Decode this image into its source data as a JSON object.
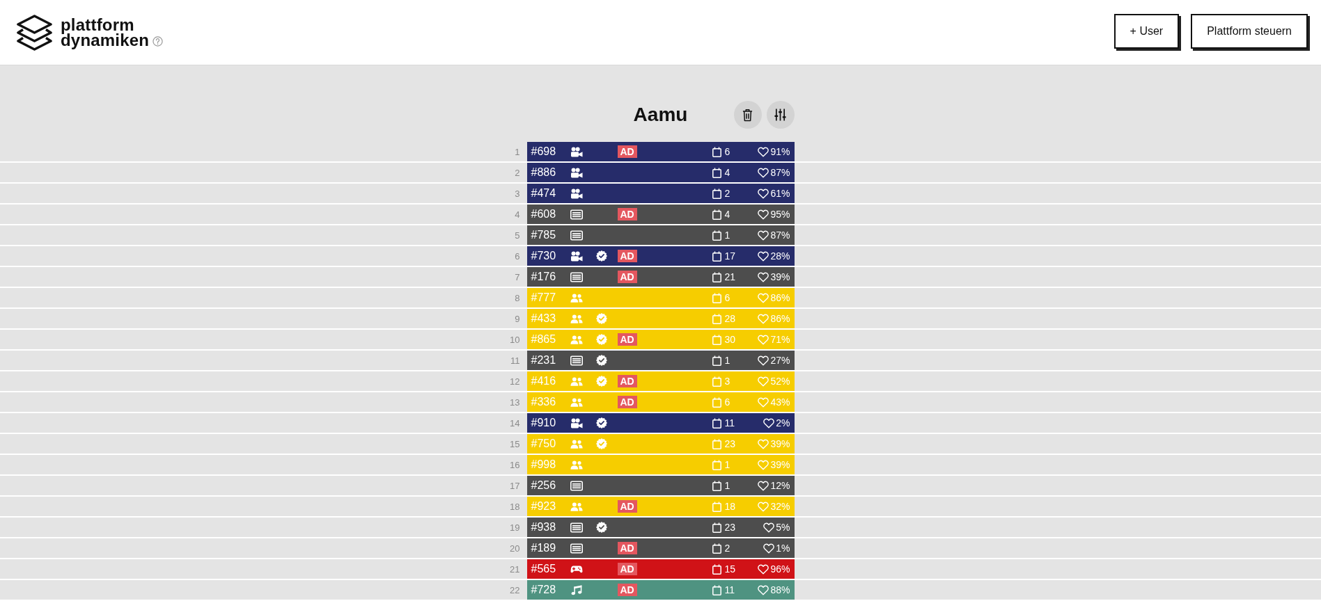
{
  "header": {
    "logo": {
      "lines": [
        "plattform",
        "dynamiken"
      ]
    },
    "buttons": [
      {
        "label": "+ User"
      },
      {
        "label": "Plattform steuern"
      }
    ]
  },
  "list": {
    "title": "Aamu",
    "rows": [
      {
        "number": "1",
        "id": "#698",
        "kind": "video",
        "color": "#262c6a",
        "verified": false,
        "badge": "AD",
        "days": "6",
        "likes": "91%"
      },
      {
        "number": "2",
        "id": "#886",
        "kind": "video",
        "color": "#262c6a",
        "verified": false,
        "days": "4",
        "likes": "87%"
      },
      {
        "number": "3",
        "id": "#474",
        "kind": "video",
        "color": "#262c6a",
        "verified": false,
        "days": "2",
        "likes": "61%"
      },
      {
        "number": "4",
        "id": "#608",
        "kind": "article",
        "color": "#4d4d4d",
        "verified": false,
        "badge": "AD",
        "days": "4",
        "likes": "95%"
      },
      {
        "number": "5",
        "id": "#785",
        "kind": "article",
        "color": "#4d4d4d",
        "verified": false,
        "days": "1",
        "likes": "87%"
      },
      {
        "number": "6",
        "id": "#730",
        "kind": "video",
        "color": "#262c6a",
        "verified": true,
        "badge": "AD",
        "days": "17",
        "likes": "28%"
      },
      {
        "number": "7",
        "id": "#176",
        "kind": "article",
        "color": "#4d4d4d",
        "verified": false,
        "badge": "AD",
        "days": "21",
        "likes": "39%"
      },
      {
        "number": "8",
        "id": "#777",
        "kind": "community",
        "color": "#f6cd00",
        "verified": false,
        "days": "6",
        "likes": "86%"
      },
      {
        "number": "9",
        "id": "#433",
        "kind": "community",
        "color": "#f6cd00",
        "verified": true,
        "days": "28",
        "likes": "86%"
      },
      {
        "number": "10",
        "id": "#865",
        "kind": "community",
        "color": "#f6cd00",
        "verified": true,
        "badge": "AD",
        "days": "30",
        "likes": "71%"
      },
      {
        "number": "11",
        "id": "#231",
        "kind": "article",
        "color": "#4d4d4d",
        "verified": true,
        "days": "1",
        "likes": "27%"
      },
      {
        "number": "12",
        "id": "#416",
        "kind": "community",
        "color": "#f6cd00",
        "verified": true,
        "badge": "AD",
        "days": "3",
        "likes": "52%"
      },
      {
        "number": "13",
        "id": "#336",
        "kind": "community",
        "color": "#f6cd00",
        "verified": false,
        "badge": "AD",
        "days": "6",
        "likes": "43%"
      },
      {
        "number": "14",
        "id": "#910",
        "kind": "video",
        "color": "#262c6a",
        "verified": true,
        "days": "11",
        "likes": "2%"
      },
      {
        "number": "15",
        "id": "#750",
        "kind": "community",
        "color": "#f6cd00",
        "verified": true,
        "days": "23",
        "likes": "39%"
      },
      {
        "number": "16",
        "id": "#998",
        "kind": "community",
        "color": "#f6cd00",
        "verified": false,
        "days": "1",
        "likes": "39%"
      },
      {
        "number": "17",
        "id": "#256",
        "kind": "article",
        "color": "#4d4d4d",
        "verified": false,
        "days": "1",
        "likes": "12%"
      },
      {
        "number": "18",
        "id": "#923",
        "kind": "community",
        "color": "#f6cd00",
        "verified": false,
        "badge": "AD",
        "days": "18",
        "likes": "32%"
      },
      {
        "number": "19",
        "id": "#938",
        "kind": "article",
        "color": "#4d4d4d",
        "verified": true,
        "days": "23",
        "likes": "5%"
      },
      {
        "number": "20",
        "id": "#189",
        "kind": "article",
        "color": "#4d4d4d",
        "verified": false,
        "badge": "AD",
        "days": "2",
        "likes": "1%"
      },
      {
        "number": "21",
        "id": "#565",
        "kind": "game",
        "color": "#d01217",
        "verified": false,
        "badge": "AD",
        "days": "15",
        "likes": "96%"
      },
      {
        "number": "22",
        "id": "#728",
        "kind": "music",
        "color": "#4f9381",
        "verified": false,
        "badge": "AD",
        "days": "11",
        "likes": "88%"
      }
    ]
  }
}
